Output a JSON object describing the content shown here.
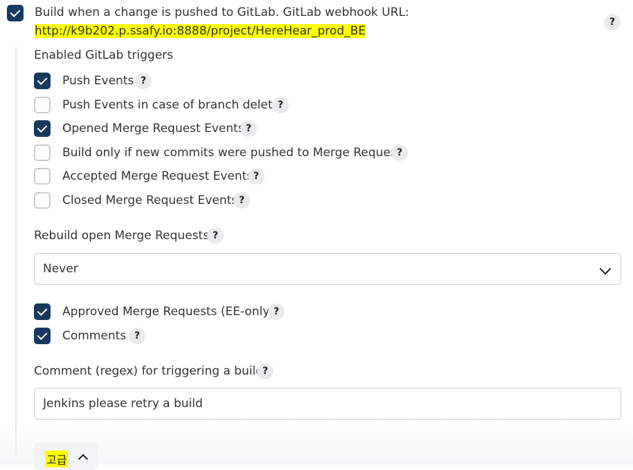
{
  "trigger": {
    "label": "Build when a change is pushed to GitLab. GitLab webhook URL:",
    "url": "http://k9b202.p.ssafy.io:8888/project/HereHear_prod_BE",
    "checked": true
  },
  "section_title": "Enabled GitLab triggers",
  "triggers": [
    {
      "label": "Push Events",
      "checked": true
    },
    {
      "label": "Push Events in case of branch delete",
      "checked": false
    },
    {
      "label": "Opened Merge Request Events",
      "checked": true
    },
    {
      "label": "Build only if new commits were pushed to Merge Request",
      "checked": false
    },
    {
      "label": "Accepted Merge Request Events",
      "checked": false
    },
    {
      "label": "Closed Merge Request Events",
      "checked": false
    }
  ],
  "rebuild": {
    "label": "Rebuild open Merge Requests",
    "value": "Never"
  },
  "extra": [
    {
      "label": "Approved Merge Requests (EE-only)",
      "checked": true
    },
    {
      "label": "Comments",
      "checked": true
    }
  ],
  "comment": {
    "label": "Comment (regex) for triggering a build",
    "value": "Jenkins please retry a build"
  },
  "advanced": {
    "label": "고급"
  },
  "help_symbol": "?"
}
